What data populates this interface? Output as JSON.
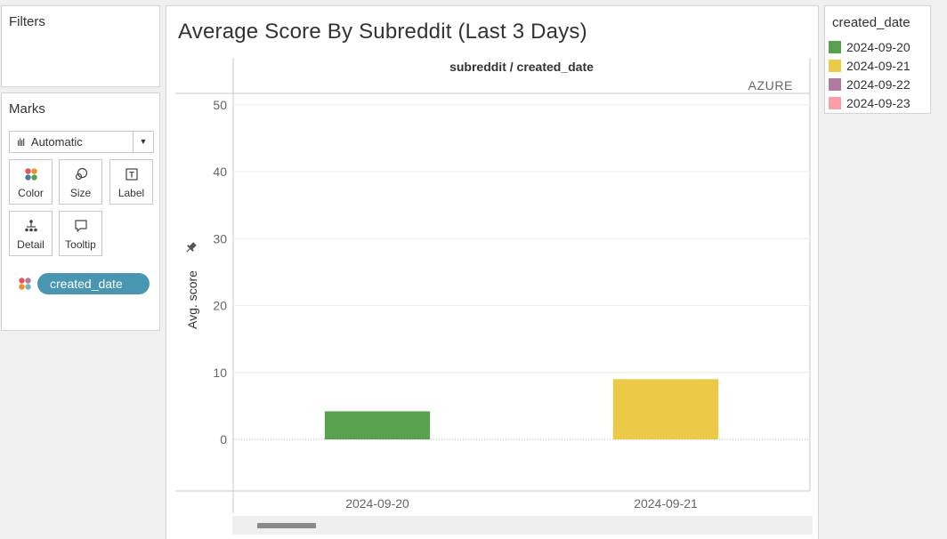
{
  "filters": {
    "title": "Filters"
  },
  "marks": {
    "title": "Marks",
    "mark_type": "Automatic",
    "buttons": [
      {
        "label": "Color",
        "icon": "color-dots-icon"
      },
      {
        "label": "Size",
        "icon": "size-icon"
      },
      {
        "label": "Label",
        "icon": "label-icon"
      },
      {
        "label": "Detail",
        "icon": "detail-icon"
      },
      {
        "label": "Tooltip",
        "icon": "tooltip-icon"
      }
    ],
    "color_pill": "created_date"
  },
  "chart": {
    "title": "Average Score By Subreddit (Last 3 Days)",
    "column_header": "subreddit / created_date",
    "pane_label": "AZURE"
  },
  "legend": {
    "title": "created_date",
    "items": [
      {
        "label": "2024-09-20",
        "color": "#59a14f"
      },
      {
        "label": "2024-09-21",
        "color": "#edc948"
      },
      {
        "label": "2024-09-22",
        "color": "#b07aa1"
      },
      {
        "label": "2024-09-23",
        "color": "#ff9da7"
      }
    ]
  },
  "chart_data": {
    "type": "bar",
    "title": "Average Score By Subreddit (Last 3 Days)",
    "xlabel": "",
    "ylabel": "Avg. score",
    "categories": [
      "2024-09-20",
      "2024-09-21"
    ],
    "values": [
      4.2,
      9.0
    ],
    "colors": [
      "#59a14f",
      "#edc948"
    ],
    "yticks": [
      0,
      10,
      20,
      30,
      40,
      50
    ],
    "ylim": [
      -7.7,
      51.7
    ],
    "grid": true
  }
}
